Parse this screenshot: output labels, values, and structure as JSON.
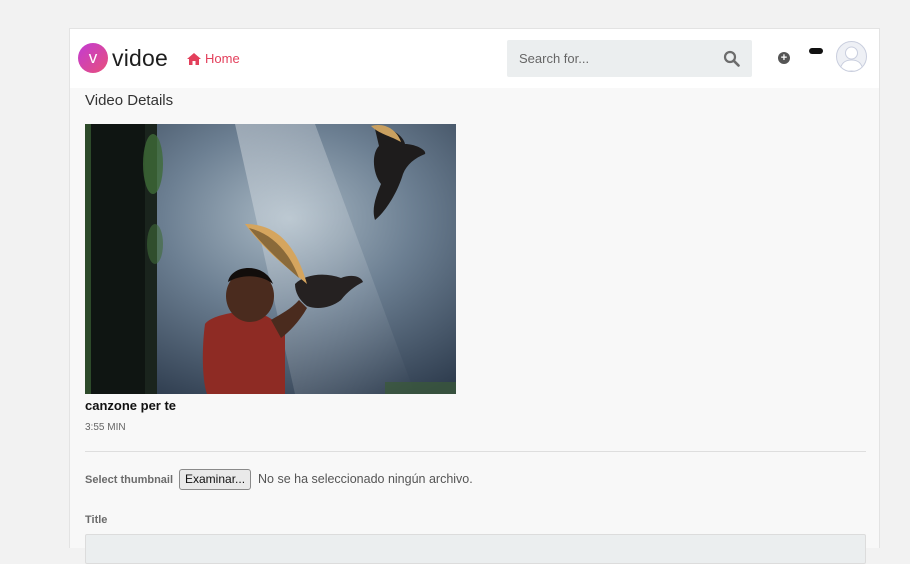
{
  "brand": {
    "logo_letter": "v",
    "name": "vidoe",
    "accent": "#e33f5b"
  },
  "nav": {
    "home_label": "Home"
  },
  "search": {
    "placeholder": "Search for..."
  },
  "header_icons": [
    "plus-circle-icon",
    "notification-pill",
    "user-avatar"
  ],
  "page": {
    "title": "Video Details"
  },
  "video": {
    "title": "canzone per te",
    "duration": "3:55 MIN"
  },
  "thumbnail_field": {
    "label": "Select thumbnail",
    "button_label": "Examinar...",
    "status": "No se ha seleccionado ningún archivo."
  },
  "title_field": {
    "label": "Title",
    "value": ""
  }
}
